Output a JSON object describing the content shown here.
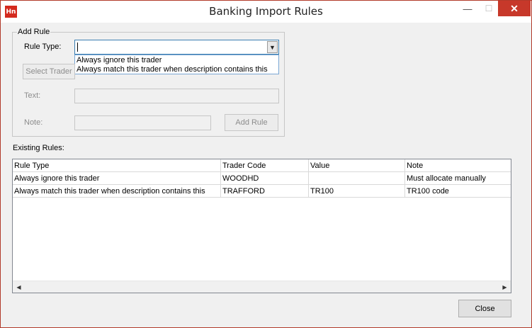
{
  "window": {
    "app_icon_text": "Hn",
    "title": "Banking Import Rules",
    "minimize_glyph": "—",
    "maximize_glyph": "☐",
    "close_glyph": "✕"
  },
  "add_rule": {
    "group_title": "Add Rule",
    "rule_type_label": "Rule Type:",
    "rule_type_value": "",
    "dropdown_options": [
      "Always ignore this trader",
      "Always match this trader when description contains this"
    ],
    "select_trader_label": "Select Trader",
    "text_label": "Text:",
    "text_value": "",
    "note_label": "Note:",
    "note_value": "",
    "add_rule_button": "Add Rule"
  },
  "existing_rules": {
    "label": "Existing Rules:",
    "columns": [
      "Rule Type",
      "Trader Code",
      "Value",
      "Note"
    ],
    "rows": [
      [
        "Always ignore this trader",
        "WOODHD",
        "",
        "Must allocate manually"
      ],
      [
        "Always match this trader when description contains this",
        "TRAFFORD",
        "TR100",
        "TR100 code"
      ]
    ]
  },
  "footer": {
    "close_button": "Close"
  },
  "colors": {
    "accent": "#d42a1e",
    "window_border": "#b23a2a",
    "focus_border": "#3c7fb1"
  }
}
